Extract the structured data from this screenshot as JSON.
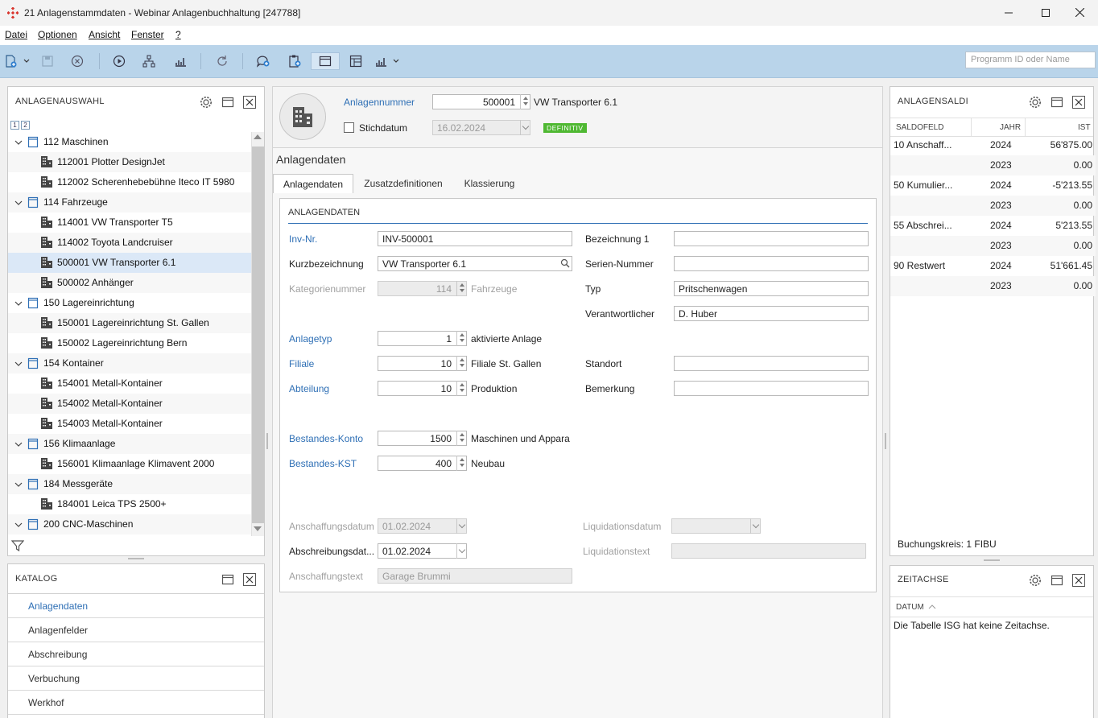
{
  "window": {
    "title": "21 Anlagenstammdaten - Webinar Anlagenbuchhaltung [247788]"
  },
  "menu": [
    "Datei",
    "Optionen",
    "Ansicht",
    "Fenster",
    "?"
  ],
  "toolbar": {
    "search_placeholder": "Programm ID oder Name"
  },
  "anlagenauswahl": {
    "title": "ANLAGENAUSWAHL",
    "level_buttons": [
      "1",
      "2"
    ],
    "rows": [
      {
        "label": "112 Maschinen",
        "group": true
      },
      {
        "label": "112001 Plotter DesignJet",
        "group": false
      },
      {
        "label": "112002 Scherenhebebühne Iteco IT 5980",
        "group": false
      },
      {
        "label": "114 Fahrzeuge",
        "group": true
      },
      {
        "label": "114001 VW Transporter T5",
        "group": false
      },
      {
        "label": "114002 Toyota Landcruiser",
        "group": false
      },
      {
        "label": "500001 VW Transporter 6.1",
        "group": false,
        "selected": true
      },
      {
        "label": "500002 Anhänger",
        "group": false
      },
      {
        "label": "150 Lagereinrichtung",
        "group": true
      },
      {
        "label": "150001 Lagereinrichtung St. Gallen",
        "group": false
      },
      {
        "label": "150002 Lagereinrichtung Bern",
        "group": false
      },
      {
        "label": "154 Kontainer",
        "group": true
      },
      {
        "label": "154001 Metall-Kontainer",
        "group": false
      },
      {
        "label": "154002 Metall-Kontainer",
        "group": false
      },
      {
        "label": "154003 Metall-Kontainer",
        "group": false
      },
      {
        "label": "156 Klimaanlage",
        "group": true
      },
      {
        "label": "156001 Klimaanlage Klimavent 2000",
        "group": false
      },
      {
        "label": "184 Messgeräte",
        "group": true
      },
      {
        "label": "184001 Leica TPS 2500+",
        "group": false
      },
      {
        "label": "200 CNC-Maschinen",
        "group": true
      }
    ]
  },
  "katalog": {
    "title": "KATALOG",
    "items": [
      "Anlagendaten",
      "Anlagenfelder",
      "Abschreibung",
      "Verbuchung",
      "Werkhof"
    ]
  },
  "header": {
    "anlagennummer_label": "Anlagennummer",
    "anlagennummer": "500001",
    "anlage_name": "VW Transporter 6.1",
    "stichdatum_label": "Stichdatum",
    "stichdatum": "16.02.2024",
    "status_badge": "DEFINITIV"
  },
  "section_title": "Anlagendaten",
  "tabs": [
    "Anlagendaten",
    "Zusatzdefinitionen",
    "Klassierung"
  ],
  "form": {
    "group_title": "ANLAGENDATEN",
    "inv_nr_label": "Inv-Nr.",
    "inv_nr": "INV-500001",
    "kurzbez_label": "Kurzbezeichnung",
    "kurzbez": "VW Transporter 6.1",
    "katnr_label": "Kategorienummer",
    "katnr": "114",
    "katnr_text": "Fahrzeuge",
    "anlagetyp_label": "Anlagetyp",
    "anlagetyp": "1",
    "anlagetyp_text": "aktivierte Anlage",
    "filiale_label": "Filiale",
    "filiale": "10",
    "filiale_text": "Filiale St. Gallen",
    "abteilung_label": "Abteilung",
    "abteilung": "10",
    "abteilung_text": "Produktion",
    "bezeichnung1_label": "Bezeichnung 1",
    "bezeichnung1": "",
    "seriennr_label": "Serien-Nummer",
    "seriennr": "",
    "typ_label": "Typ",
    "typ": "Pritschenwagen",
    "verantw_label": "Verantwortlicher",
    "verantw": "D. Huber",
    "standort_label": "Standort",
    "standort": "",
    "bemerkung_label": "Bemerkung",
    "bemerkung": "",
    "bestkonto_label": "Bestandes-Konto",
    "bestkonto": "1500",
    "bestkonto_text": "Maschinen und Appara",
    "bestkst_label": "Bestandes-KST",
    "bestkst": "400",
    "bestkst_text": "Neubau",
    "anschdatum_label": "Anschaffungsdatum",
    "anschdatum": "01.02.2024",
    "abschrdatum_label": "Abschreibungsdat...",
    "abschrdatum": "01.02.2024",
    "anschtext_label": "Anschaffungstext",
    "anschtext": "Garage Brummi",
    "liqdatum_label": "Liquidationsdatum",
    "liqdatum": "",
    "liqtext_label": "Liquidationstext",
    "liqtext": ""
  },
  "saldi": {
    "title": "ANLAGENSALDI",
    "columns": [
      "SALDOFELD",
      "JAHR",
      "IST"
    ],
    "rows": [
      {
        "feld": "10 Anschaff...",
        "jahr": "2024",
        "ist": "56'875.00"
      },
      {
        "feld": "",
        "jahr": "2023",
        "ist": "0.00"
      },
      {
        "feld": "50 Kumulier...",
        "jahr": "2024",
        "ist": "-5'213.55"
      },
      {
        "feld": "",
        "jahr": "2023",
        "ist": "0.00"
      },
      {
        "feld": "55 Abschrei...",
        "jahr": "2024",
        "ist": "5'213.55"
      },
      {
        "feld": "",
        "jahr": "2023",
        "ist": "0.00"
      },
      {
        "feld": "90 Restwert",
        "jahr": "2024",
        "ist": "51'661.45"
      },
      {
        "feld": "",
        "jahr": "2023",
        "ist": "0.00"
      }
    ],
    "footer": "Buchungskreis: 1 FIBU"
  },
  "zeitachse": {
    "title": "ZEITACHSE",
    "column": "DATUM",
    "message": "Die Tabelle ISG hat keine Zeitachse."
  }
}
